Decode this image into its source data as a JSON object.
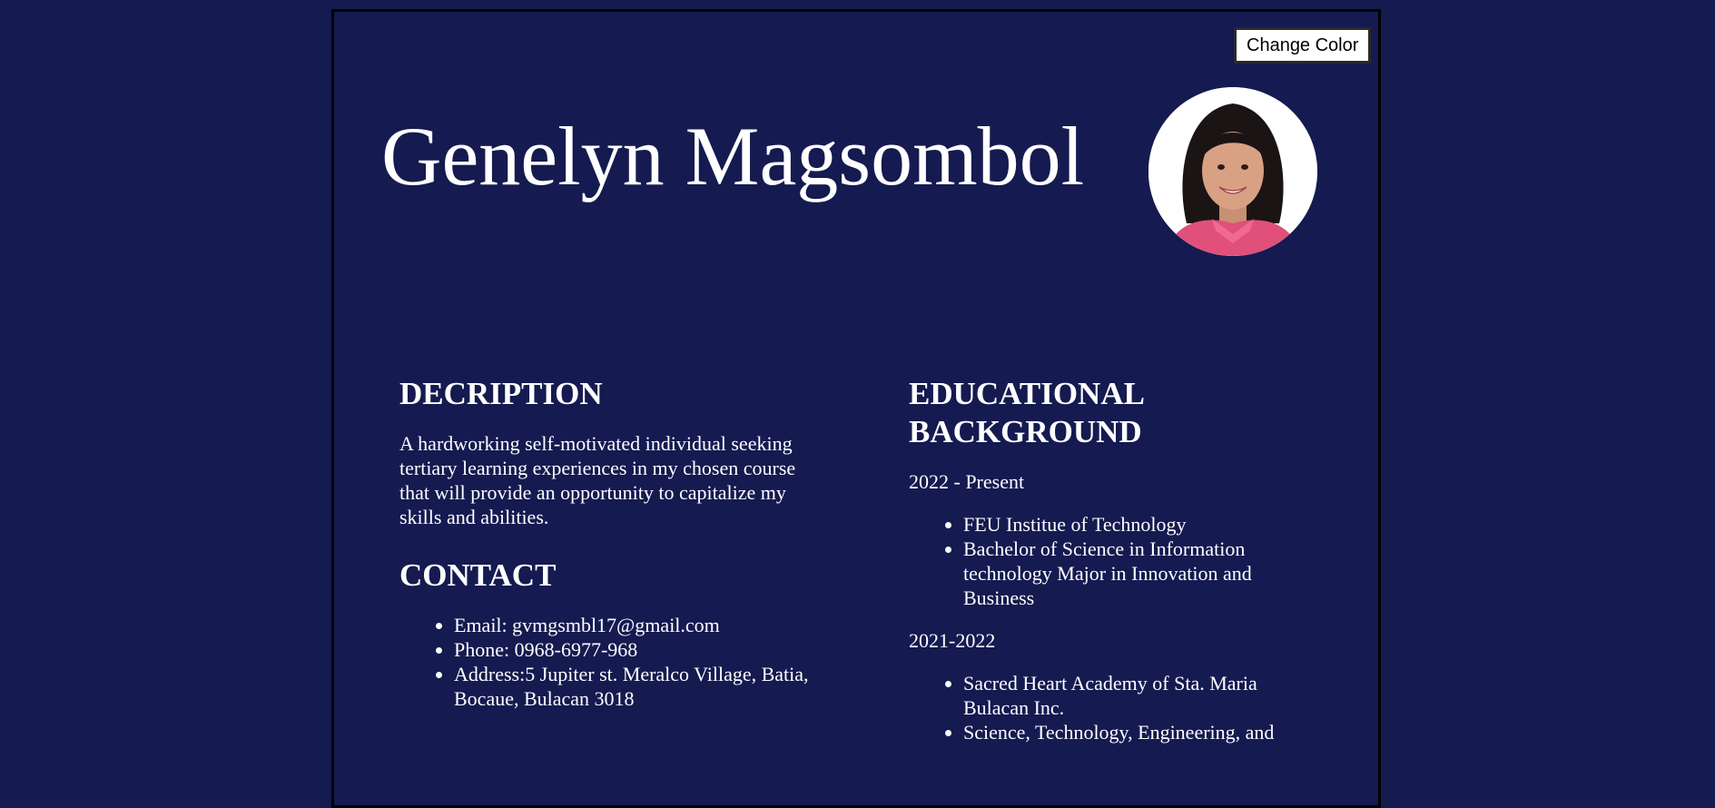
{
  "header": {
    "change_color_label": "Change Color",
    "name": "Genelyn Magsombol"
  },
  "description": {
    "heading": "DECRIPTION",
    "text": "A hardworking self-motivated individual seeking tertiary learning experiences in my chosen course that will provide an opportunity to capitalize my skills and abilities."
  },
  "contact": {
    "heading": "CONTACT",
    "items": [
      "Email: gvmgsmbl17@gmail.com",
      "Phone: 0968-6977-968",
      "Address:5 Jupiter st. Meralco Village, Batia, Bocaue, Bulacan 3018"
    ]
  },
  "education": {
    "heading": "EDUCATIONAL BACKGROUND",
    "entries": [
      {
        "years": "2022 - Present",
        "items": [
          "FEU Institue of Technology",
          "Bachelor of Science in Information technology Major in Innovation and Business"
        ]
      },
      {
        "years": "2021-2022",
        "items": [
          "Sacred Heart Academy of Sta. Maria Bulacan Inc.",
          "Science, Technology, Engineering, and"
        ]
      }
    ]
  },
  "colors": {
    "background": "#151a50",
    "text": "#ffffff",
    "shirt": "#e0507a"
  }
}
